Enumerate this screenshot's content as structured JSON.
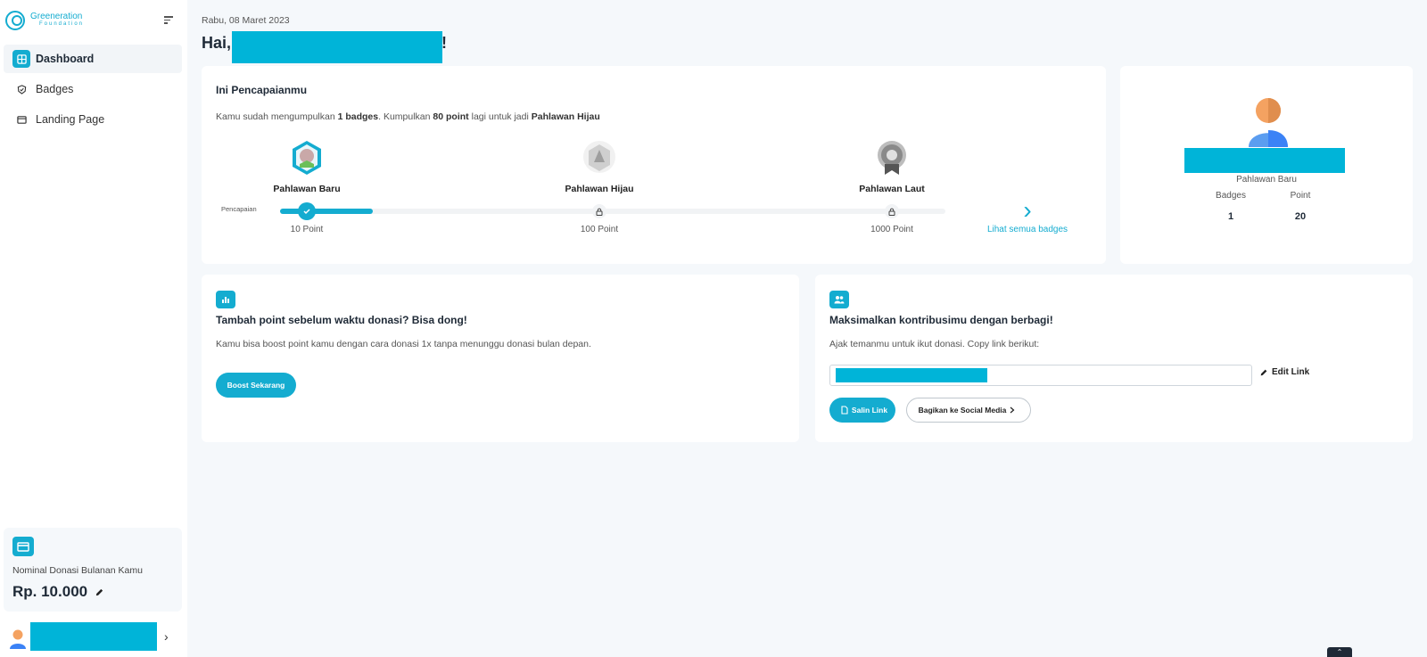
{
  "brand": {
    "name_line1": "Greeneration",
    "name_line2": "Foundation",
    "accent": "#14acd0",
    "redact": "#00b4d8"
  },
  "sidebar": {
    "items": [
      {
        "label": "Dashboard",
        "icon": "dashboard-icon",
        "active": true
      },
      {
        "label": "Badges",
        "icon": "badge-icon",
        "active": false
      },
      {
        "label": "Landing Page",
        "icon": "window-icon",
        "active": false
      }
    ],
    "donasi": {
      "label": "Nominal Donasi Bulanan Kamu",
      "amount": "Rp. 10.000"
    }
  },
  "header": {
    "date": "Rabu, 08 Maret 2023",
    "greeting": "Hai,",
    "greeting_end": "!"
  },
  "achievement": {
    "title": "Ini Pencapaianmu",
    "text_pre": "Kamu sudah mengumpulkan ",
    "badges_count": "1 badges",
    "text_mid": ". Kumpulkan ",
    "points_needed": "80 point",
    "text_post": " lagi untuk jadi ",
    "next_badge": "Pahlawan Hijau",
    "progress_label": "Pencapaian",
    "progress_fraction": 0.14,
    "badges": [
      {
        "name": "Pahlawan Baru",
        "point": "10 Point",
        "unlocked": true
      },
      {
        "name": "Pahlawan Hijau",
        "point": "100 Point",
        "unlocked": false
      },
      {
        "name": "Pahlawan Laut",
        "point": "1000 Point",
        "unlocked": false
      }
    ],
    "see_all": "Lihat semua badges"
  },
  "profile": {
    "rank": "Pahlawan Baru",
    "badges_label": "Badges",
    "badges_value": "1",
    "point_label": "Point",
    "point_value": "20"
  },
  "boost": {
    "title": "Tambah point sebelum waktu donasi? Bisa dong!",
    "text": "Kamu bisa boost point kamu dengan cara donasi 1x tanpa menunggu donasi bulan depan.",
    "button": "Boost Sekarang"
  },
  "share": {
    "title": "Maksimalkan kontribusimu dengan berbagi!",
    "text": "Ajak temanmu untuk ikut donasi. Copy link berikut:",
    "edit_link": "Edit Link",
    "copy_button": "Salin Link",
    "social_button": "Bagikan ke Social Media"
  }
}
